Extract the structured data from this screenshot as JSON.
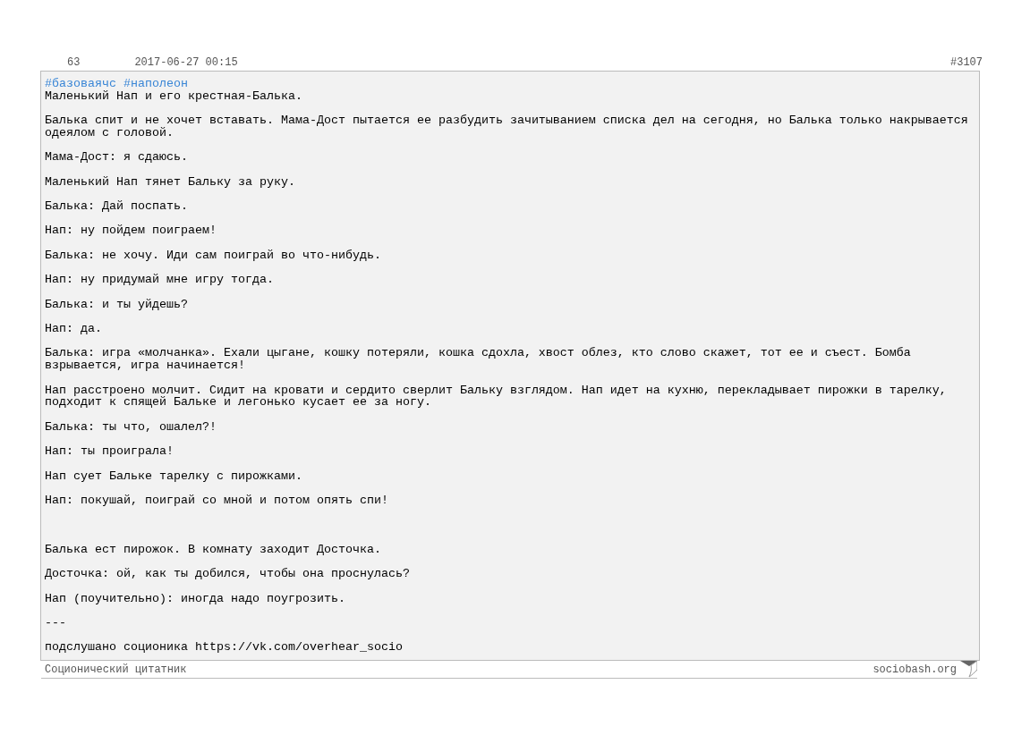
{
  "quote": {
    "rating": "63",
    "date": "2017-06-27 00:15",
    "number": "#3107",
    "tags": [
      "#базоваячс",
      "#наполеон"
    ],
    "text": "Маленький Нап и его крестная-Балька.\n\nБалька спит и не хочет вставать. Мама-Дост пытается ее разбудить зачитыванием списка дел на сегодня, но Балька только накрывается одеялом с головой.\n\nМама-Дост: я сдаюсь.\n\nМаленький Нап тянет Бальку за руку.\n\nБалька: Дай поспать.\n\nНап: ну пойдем поиграем!\n\nБалька: не хочу. Иди сам поиграй во что-нибудь.\n\nНап: ну придумай мне игру тогда.\n\nБалька: и ты уйдешь?\n\nНап: да.\n\nБалька: игра «молчанка». Ехали цыгане, кошку потеряли, кошка сдохла, хвост облез, кто слово скажет, тот ее и съест. Бомба взрывается, игра начинается!\n\nНап расстроено молчит. Сидит на кровати и сердито сверлит Бальку взглядом. Нап идет на кухню, перекладывает пирожки в тарелку, подходит к спящей Бальке и легонько кусает ее за ногу.\n\nБалька: ты что, ошалел?!\n\nНап: ты проиграла!\n\nНап сует Бальке тарелку с пирожками.\n\nНап: покушай, поиграй со мной и потом опять спи!\n\n\n\nБалька ест пирожок. В комнату заходит Досточка.\n\nДосточка: ой, как ты добился, чтобы она проснулась?\n\nНап (поучительно): иногда надо поугрозить.\n\n---\n\nподслушано соционика https://vk.com/overhear_socio"
  },
  "footer": {
    "site_name": "Соционический цитатник",
    "domain": "sociobash.org"
  }
}
